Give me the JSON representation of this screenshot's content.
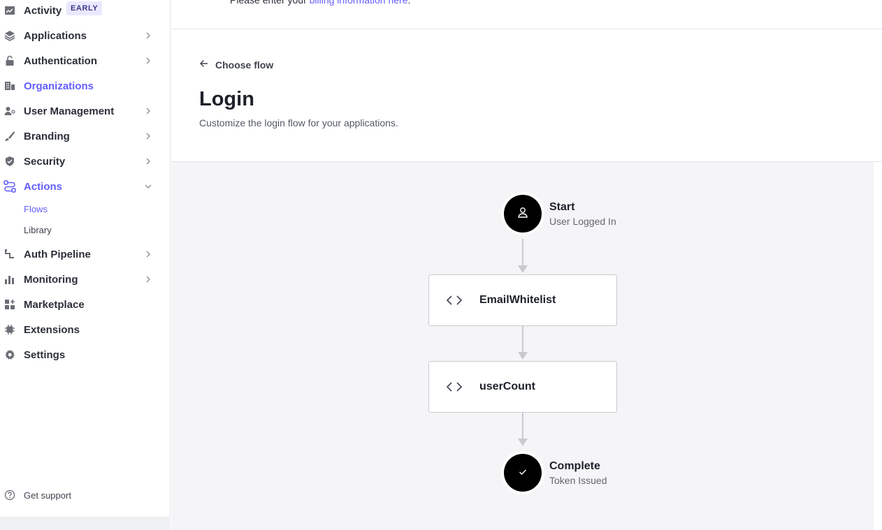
{
  "sidebar": {
    "items": [
      {
        "label": "Activity",
        "icon": "activity-icon",
        "badge": "EARLY"
      },
      {
        "label": "Applications",
        "icon": "layers-icon"
      },
      {
        "label": "Authentication",
        "icon": "lock-icon"
      },
      {
        "label": "Organizations",
        "icon": "building-icon"
      },
      {
        "label": "User Management",
        "icon": "users-icon"
      },
      {
        "label": "Branding",
        "icon": "brush-icon"
      },
      {
        "label": "Security",
        "icon": "shield-icon"
      },
      {
        "label": "Actions",
        "icon": "actions-icon"
      },
      {
        "label": "Auth Pipeline",
        "icon": "pipeline-icon"
      },
      {
        "label": "Monitoring",
        "icon": "bar-chart-icon"
      },
      {
        "label": "Marketplace",
        "icon": "marketplace-icon"
      },
      {
        "label": "Extensions",
        "icon": "extensions-icon"
      },
      {
        "label": "Settings",
        "icon": "gear-icon"
      }
    ],
    "actions_sub": [
      {
        "label": "Flows"
      },
      {
        "label": "Library"
      }
    ],
    "support_label": "Get support"
  },
  "banner": {
    "text_prefix": "Please enter your ",
    "link_text": "billing information here",
    "text_suffix": "."
  },
  "header": {
    "back_label": "Choose flow",
    "title": "Login",
    "subtitle": "Customize the login flow for your applications."
  },
  "flow": {
    "start": {
      "title": "Start",
      "subtitle": "User Logged In"
    },
    "actions": [
      {
        "label": "EmailWhitelist"
      },
      {
        "label": "userCount"
      }
    ],
    "complete": {
      "title": "Complete",
      "subtitle": "Token Issued"
    }
  },
  "colors": {
    "accent": "#635dff",
    "text": "#1e212a",
    "muted": "#545964",
    "canvas": "#f5f5f7",
    "border": "#c9cacf"
  }
}
